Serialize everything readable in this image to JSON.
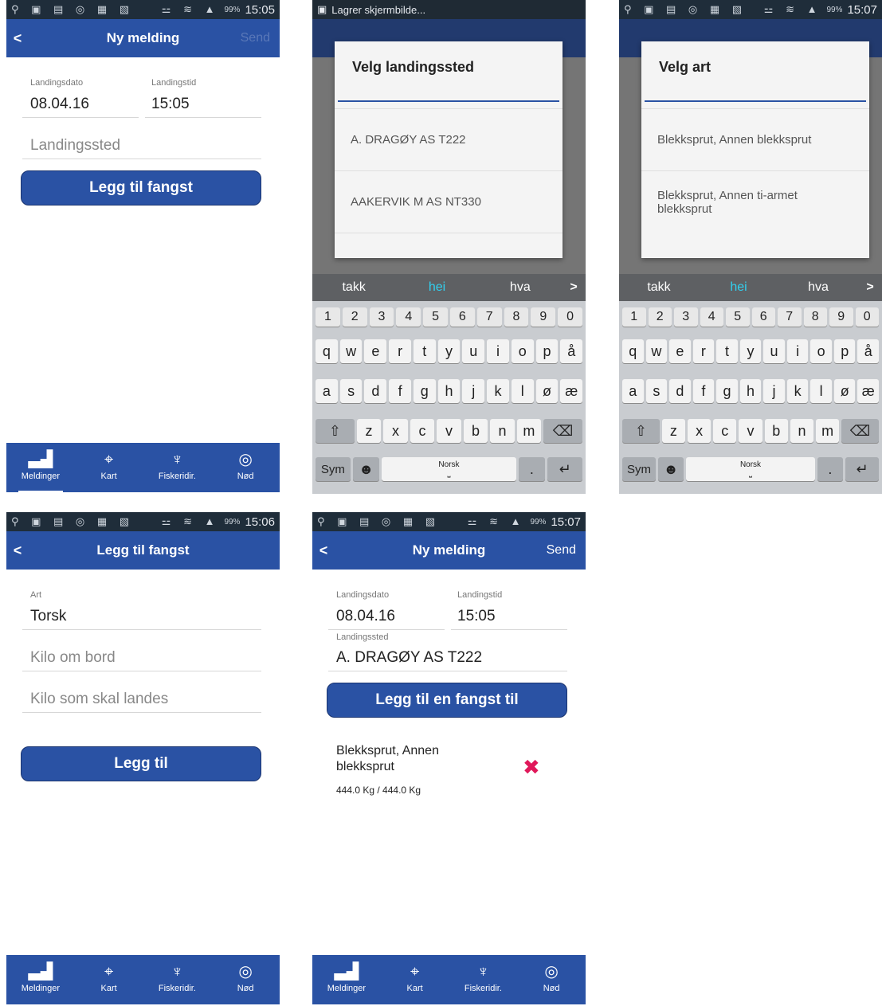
{
  "status": {
    "icons": "⚲ ▣ ▤ ◎ ▦ ▧",
    "signal": "⚍ ≋ ▲",
    "battery": "99%",
    "banner": "Lagrer skjermbilde..."
  },
  "screen1": {
    "time": "15:05",
    "title": "Ny melding",
    "send": "Send",
    "date_label": "Landingsdato",
    "date_value": "08.04.16",
    "time_label": "Landingstid",
    "time_value": "15:05",
    "place_placeholder": "Landingssted",
    "button": "Legg til fangst"
  },
  "dialog_place": {
    "title": "Velg landingssted",
    "items": [
      "A. DRAGØY AS T222",
      "AAKERVIK M AS NT330"
    ]
  },
  "dialog_species": {
    "time": "15:07",
    "title": "Velg art",
    "items": [
      "Blekksprut, Annen blekksprut",
      "Blekksprut, Annen ti-armet blekksprut"
    ]
  },
  "keyboard": {
    "suggestions": [
      "takk",
      "hei",
      "hva"
    ],
    "arrow": ">",
    "numbers": [
      "1",
      "2",
      "3",
      "4",
      "5",
      "6",
      "7",
      "8",
      "9",
      "0"
    ],
    "row1": [
      "q",
      "w",
      "e",
      "r",
      "t",
      "y",
      "u",
      "i",
      "o",
      "p",
      "å"
    ],
    "row2": [
      "a",
      "s",
      "d",
      "f",
      "g",
      "h",
      "j",
      "k",
      "l",
      "ø",
      "æ"
    ],
    "row3": [
      "z",
      "x",
      "c",
      "v",
      "b",
      "n",
      "m"
    ],
    "shift": "⇧",
    "backspace": "⌫",
    "sym": "Sym",
    "emoji": "☻",
    "space_label": "Norsk",
    "space_glyph": "⎵",
    "dot": ".",
    "enter": "↵"
  },
  "screen4": {
    "time": "15:06",
    "title": "Legg til fangst",
    "art_label": "Art",
    "art_value": "Torsk",
    "kilo_board": "Kilo om bord",
    "kilo_land": "Kilo som skal landes",
    "button": "Legg til"
  },
  "screen5": {
    "time": "15:07",
    "title": "Ny melding",
    "send": "Send",
    "date_label": "Landingsdato",
    "date_value": "08.04.16",
    "time_label": "Landingstid",
    "time_value": "15:05",
    "place_label": "Landingssted",
    "place_value": "A. DRAGØY AS T222",
    "button": "Legg til en fangst til",
    "catch_name": "Blekksprut, Annen blekksprut",
    "catch_kg": "444.0 Kg / 444.0 Kg",
    "delete": "✖"
  },
  "nav": {
    "items": [
      {
        "label": "Meldinger",
        "icon": "▃▟"
      },
      {
        "label": "Kart",
        "icon": "⌖"
      },
      {
        "label": "Fiskeridir.",
        "icon": "♆"
      },
      {
        "label": "Nød",
        "icon": "◎"
      }
    ]
  },
  "colors": {
    "primary": "#2a52a4",
    "accent": "#31d0f0",
    "delete": "#e0185a"
  }
}
